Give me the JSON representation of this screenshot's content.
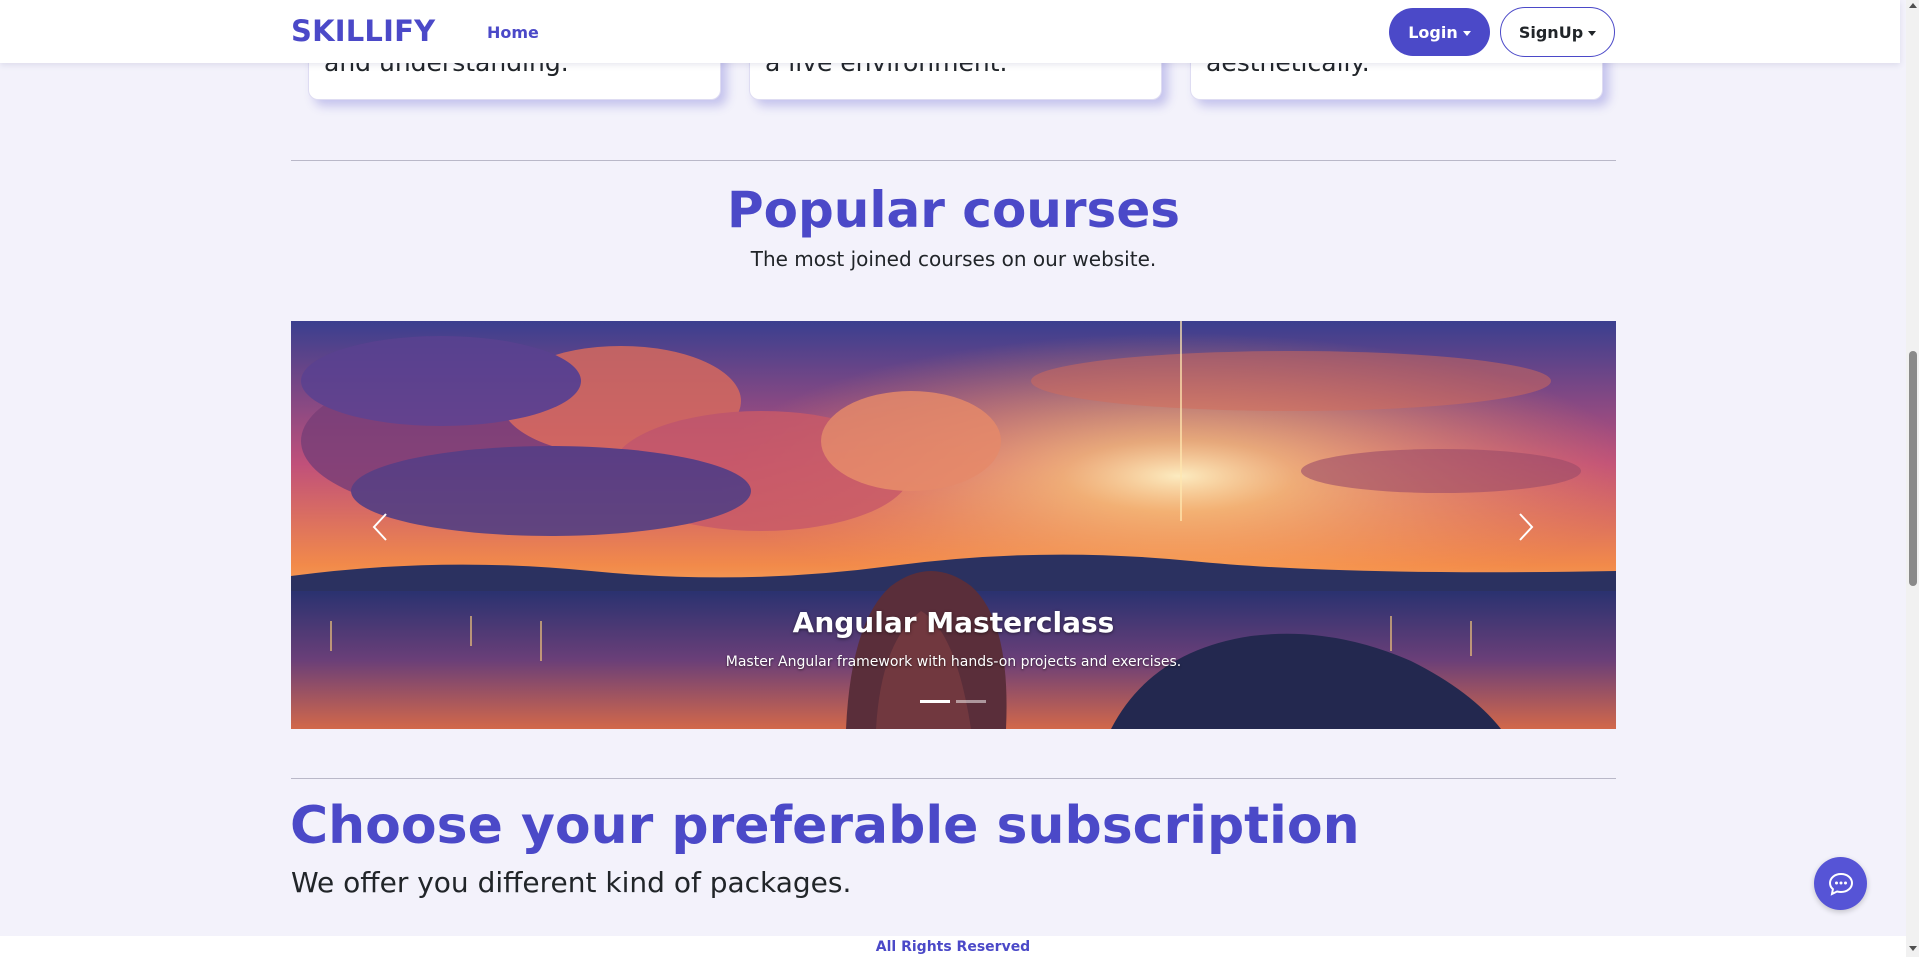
{
  "navbar": {
    "brand": "SKILLIFY",
    "home_link": "Home",
    "login_label": "Login",
    "signup_label": "SignUp"
  },
  "features": [
    {
      "text_fragment": "and understanding."
    },
    {
      "text_fragment": "a live environment."
    },
    {
      "text_fragment": "aesthetically."
    }
  ],
  "popular_courses": {
    "title": "Popular courses",
    "subtitle": "The most joined courses on our website.",
    "carousel": {
      "active_slide": {
        "title": "Angular Masterclass",
        "description": "Master Angular framework with hands-on projects and exercises."
      },
      "indicators": 2,
      "active_indicator": 1
    }
  },
  "subscription": {
    "title": "Choose your preferable subscription",
    "subtitle": "We offer you different kind of packages."
  },
  "footer": {
    "text": "All Rights Reserved"
  },
  "icons": {
    "chat": "chat-bubble-icon",
    "prev": "chevron-left-icon",
    "next": "chevron-right-icon"
  },
  "colors": {
    "brand": "#4b49c8",
    "page_background": "#f3f2fb",
    "chat_button": "#5654d6"
  }
}
